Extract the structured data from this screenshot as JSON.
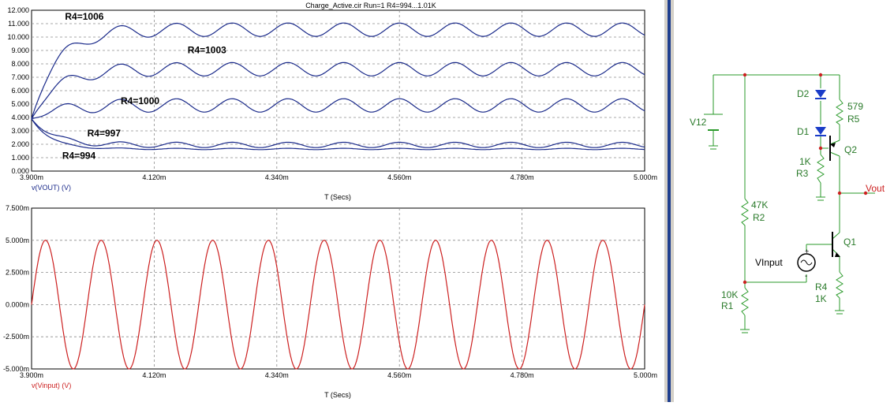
{
  "window": {
    "title": "Charge_Active.cir Run=1 R4=994...1.01K"
  },
  "colors": {
    "vout": "#1a2a8a",
    "vin": "#cc2020",
    "grid": "#8c8c8c",
    "schematic_wire": "#2a9a2a",
    "schematic_label": "#2a7a2a",
    "diode": "#1a3cc8",
    "node": "#cc2020"
  },
  "chart_data": [
    {
      "type": "line",
      "trace_label": "v(VOUT) (V)",
      "xlabel": "T (Secs)",
      "xlim": [
        3.9,
        5.0
      ],
      "ylim": [
        0,
        12
      ],
      "x_ticks": [
        "3.900m",
        "4.120m",
        "4.340m",
        "4.560m",
        "4.780m",
        "5.000m"
      ],
      "y_ticks": [
        "0.000",
        "1.000",
        "2.000",
        "3.000",
        "4.000",
        "5.000",
        "6.000",
        "7.000",
        "8.000",
        "9.000",
        "10.000",
        "11.000",
        "12.000"
      ],
      "grid": true,
      "curve_start": 3.9,
      "period": 0.1,
      "series": [
        {
          "name": "R4=1006",
          "start": 3.9,
          "final": 10.55,
          "amp": 0.5,
          "tau": 0.045
        },
        {
          "name": "R4=1003",
          "start": 3.9,
          "final": 7.6,
          "amp": 0.5,
          "tau": 0.045
        },
        {
          "name": "R4=1000",
          "start": 3.9,
          "final": 4.9,
          "amp": 0.5,
          "tau": 0.045
        },
        {
          "name": "R4=997",
          "start": 3.9,
          "final": 1.95,
          "amp": 0.2,
          "tau": 0.04
        },
        {
          "name": "R4=994",
          "start": 3.9,
          "final": 1.65,
          "amp": 0.05,
          "tau": 0.035
        }
      ],
      "annotations": [
        {
          "text": "R4=1006",
          "x": 3.96,
          "y": 11.3
        },
        {
          "text": "R4=1003",
          "x": 4.18,
          "y": 8.8
        },
        {
          "text": "R4=1000",
          "x": 4.06,
          "y": 5.0
        },
        {
          "text": "R4=997",
          "x": 4.0,
          "y": 2.6
        },
        {
          "text": "R4=994",
          "x": 3.955,
          "y": 0.9
        }
      ]
    },
    {
      "type": "line",
      "trace_label": "v(Vinput) (V)",
      "xlabel": "T (Secs)",
      "xlim": [
        3.9,
        5.0
      ],
      "ylim": [
        -5,
        7.5
      ],
      "x_ticks": [
        "3.900m",
        "4.120m",
        "4.340m",
        "4.560m",
        "4.780m",
        "5.000m"
      ],
      "y_ticks": [
        "-5.000m",
        "-2.500m",
        "0.000m",
        "2.500m",
        "5.000m",
        "7.500m"
      ],
      "grid": true,
      "series": [
        {
          "name": "",
          "amplitude": 5,
          "period": 0.1,
          "phase_start": 3.9
        }
      ]
    }
  ],
  "schematic": {
    "labels": {
      "v12": "V12",
      "d2": "D2",
      "d1": "D1",
      "r5_val": "579",
      "r5": "R5",
      "q2": "Q2",
      "r3_val": "1K",
      "r3": "R3",
      "vout": "Vout",
      "r2_val": "47K",
      "r2": "R2",
      "q1": "Q1",
      "vinput": "VInput",
      "r4": "R4",
      "r4_val": "1K",
      "r1_val": "10K",
      "r1": "R1",
      "plus": "+",
      "minus": "-"
    }
  }
}
